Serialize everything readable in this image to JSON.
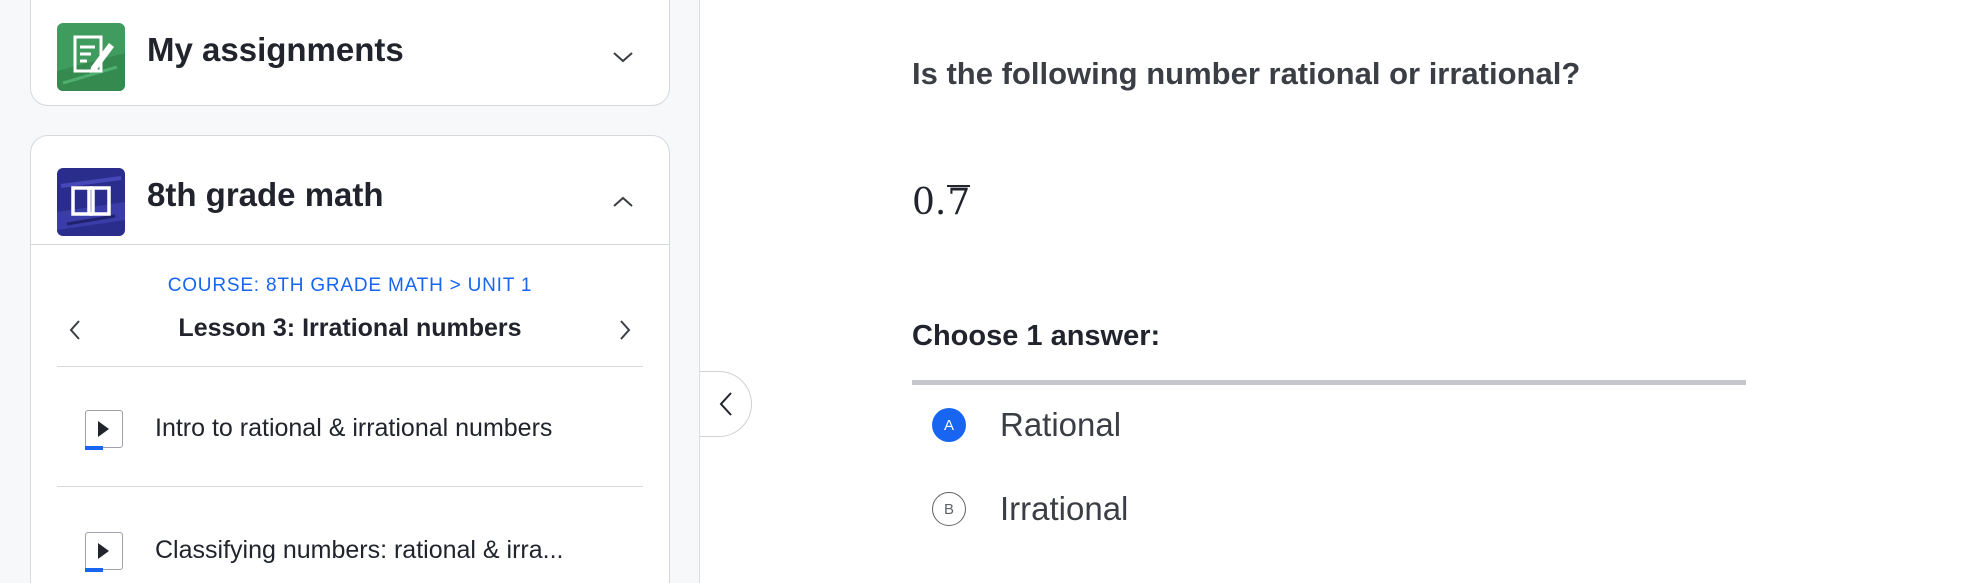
{
  "sidebar": {
    "assignments": {
      "title": "My assignments",
      "icon": "assignment-icon",
      "chevron": "chevron-down-icon"
    },
    "course": {
      "title": "8th grade math",
      "icon": "book-icon",
      "chevron": "chevron-up-icon",
      "breadcrumb": "COURSE: 8TH GRADE MATH > UNIT 1",
      "lesson_title": "Lesson 3: Irrational numbers",
      "items": [
        {
          "label": "Intro to rational & irrational numbers",
          "type": "video"
        },
        {
          "label": "Classifying numbers: rational & irra...",
          "type": "video"
        }
      ]
    }
  },
  "exercise": {
    "question": "Is the following number rational or irrational?",
    "math_base": "0.",
    "math_repeat": "7",
    "prompt": "Choose 1 answer:",
    "choices": [
      {
        "letter": "A",
        "text": "Rational",
        "selected": true
      },
      {
        "letter": "B",
        "text": "Irrational",
        "selected": false
      }
    ]
  },
  "colors": {
    "accent": "#1865f2",
    "text": "#21242c",
    "border": "#d6d8dd",
    "assign_icon": "#3f9b5e",
    "course_icon": "#2b2d8c"
  }
}
